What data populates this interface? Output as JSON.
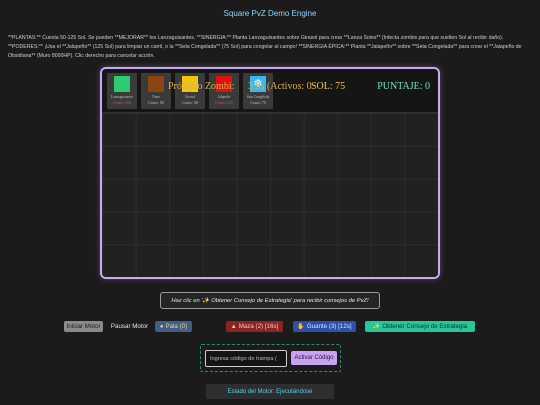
{
  "header": {
    "title": "Square PvZ Demo Engine"
  },
  "instructions": "**PLANTAS:** Cuesta 50-125 Sol. Se pueden **MEJORAR** los Lanzaguisantes. **SINERGIA:** Planta Lanzaguisantes sobre Girasol para crear **Lanza Soles** (Infecta zombis para que suelten Sol al recibir daño). **PODERES:** ¡Usa el **Jalapeño** (125 Sol) para limpiar un carril, o la **Seta Congelada** (75 Sol) para congelar al campo! **SINERGIA ÉPICA:** Planta **Jalapeño** sobre **Seta Congelada** para crear el **Jalapeño de Obsidiana** (Muro 8000HP). Clic derecho para cancelar acción.",
  "hud": {
    "cards": [
      {
        "name": "Lanzaguisantes",
        "cost": "Costo: 100",
        "color": "#2ecc71",
        "icon": "square",
        "dim": true
      },
      {
        "name": "Nuez",
        "cost": "Costo: 50",
        "color": "#8b4513",
        "icon": "square",
        "dim": false
      },
      {
        "name": "Girasol",
        "cost": "Costo: 50",
        "color": "#f1c40f",
        "icon": "square",
        "dim": false
      },
      {
        "name": "Jalapeño",
        "cost": "Costo: 125",
        "color": "#e01010",
        "icon": "square",
        "dim": true
      },
      {
        "name": "Seta Congelada",
        "cost": "Costo: 75",
        "color": "#36b8f5",
        "icon": "snowflake",
        "glyph": "❄",
        "dim": false
      }
    ],
    "timer_prefix": "Próximo Zombi:",
    "timer_rest": "3.9s (Activos: 0",
    "sun": "SOL: 75",
    "score": "PUNTAJE: 0"
  },
  "advice_text": "Haz clic en '✨ Obtener Consejo de Estrategia' para recibir consejos de PvZ!",
  "controls": {
    "start": "Iniciar Motor",
    "pause": "Pausar Motor",
    "pala": "Pala (0)",
    "maza": "Maza (2) [16s]",
    "guante": "Guante (3) [12s]",
    "consejo": "Obtener Consejo de Estrategia"
  },
  "cheat": {
    "placeholder": "Ingresa código de trampa (",
    "button": "Activar Código"
  },
  "status": "Estado del Motor: Ejecutándose"
}
